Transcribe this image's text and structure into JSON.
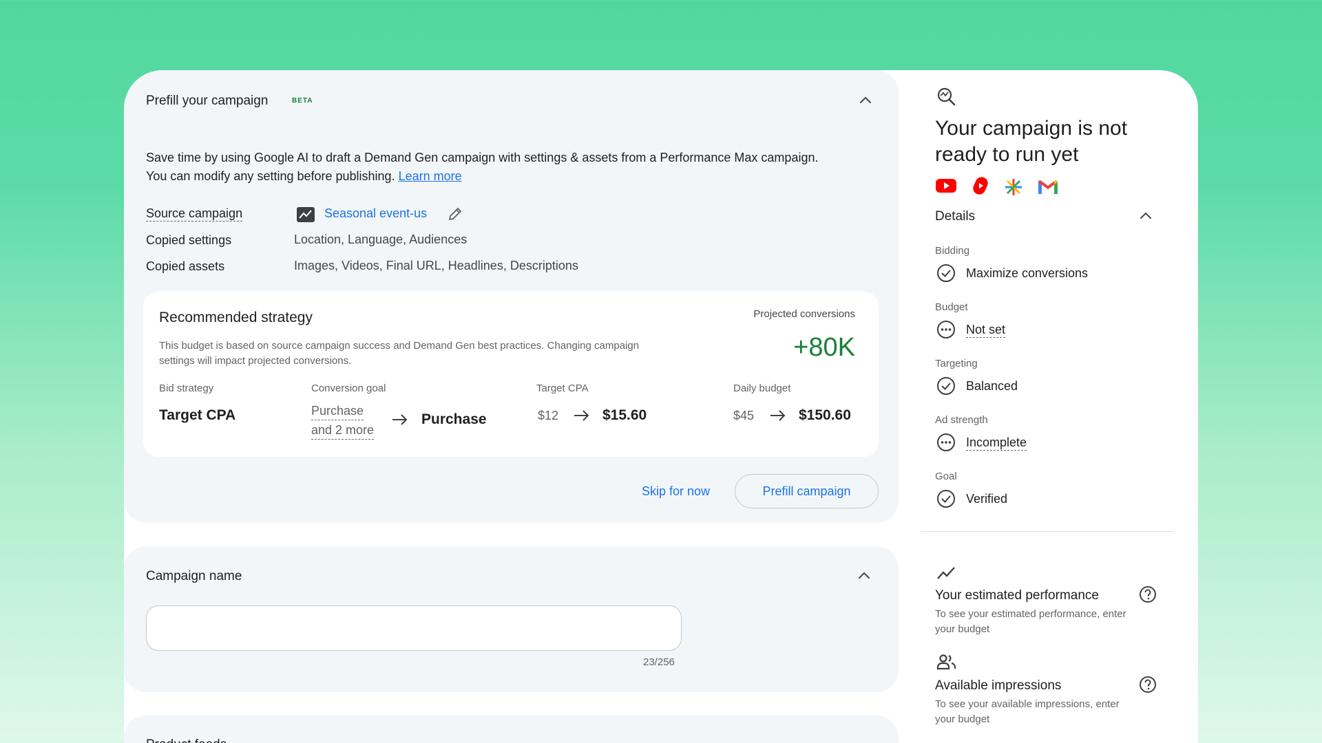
{
  "prefill": {
    "title": "Prefill your campaign",
    "badge": "BETA",
    "description": "Save time by using Google AI to draft a Demand Gen campaign with settings & assets from a Performance Max campaign. You can modify any setting before publishing.",
    "learn_more": "Learn more",
    "source_label": "Source campaign",
    "source_value": "Seasonal event-us",
    "settings_label": "Copied settings",
    "settings_value": "Location, Language, Audiences",
    "assets_label": "Copied assets",
    "assets_value": "Images, Videos, Final URL, Headlines, Descriptions",
    "strategy": {
      "title": "Recommended strategy",
      "description": "This budget is based on source campaign success and Demand Gen best practices. Changing campaign settings will impact projected conversions.",
      "projected_label": "Projected conversions",
      "projected_value": "+80K",
      "bid_label": "Bid strategy",
      "bid_value": "Target CPA",
      "goal_label": "Conversion goal",
      "goal_from_line1": "Purchase",
      "goal_from_line2": "and 2 more",
      "goal_to": "Purchase",
      "cpa_label": "Target CPA",
      "cpa_from": "$12",
      "cpa_to": "$15.60",
      "daily_label": "Daily budget",
      "daily_from": "$45",
      "daily_to": "$150.60"
    },
    "skip_label": "Skip for now",
    "prefill_button": "Prefill campaign"
  },
  "campaign_name": {
    "title": "Campaign name",
    "value": "",
    "counter": "23/256"
  },
  "product_feeds": {
    "title": "Product feeds"
  },
  "readiness": {
    "title": "Your campaign is not ready to run yet",
    "channels": [
      "youtube-icon",
      "shorts-icon",
      "discover-icon",
      "gmail-icon"
    ],
    "details_label": "Details",
    "items": [
      {
        "label": "Bidding",
        "status": "Maximize conversions",
        "icon": "check-circle-icon"
      },
      {
        "label": "Budget",
        "status": "Not set",
        "icon": "pending-circle-icon"
      },
      {
        "label": "Targeting",
        "status": "Balanced",
        "icon": "check-circle-icon"
      },
      {
        "label": "Ad strength",
        "status": "Incomplete",
        "icon": "pending-circle-icon"
      },
      {
        "label": "Goal",
        "status": "Verified",
        "icon": "check-circle-icon"
      }
    ],
    "performance_title": "Your estimated performance",
    "performance_sub": "To see your estimated performance, enter your budget",
    "impressions_title": "Available impressions",
    "impressions_sub": "To see your available impressions, enter your budget"
  },
  "colors": {
    "background_top": "#52d89d",
    "accent_blue": "#1a73e8",
    "positive_green": "#188038",
    "card_bg": "#f3f6f8"
  }
}
